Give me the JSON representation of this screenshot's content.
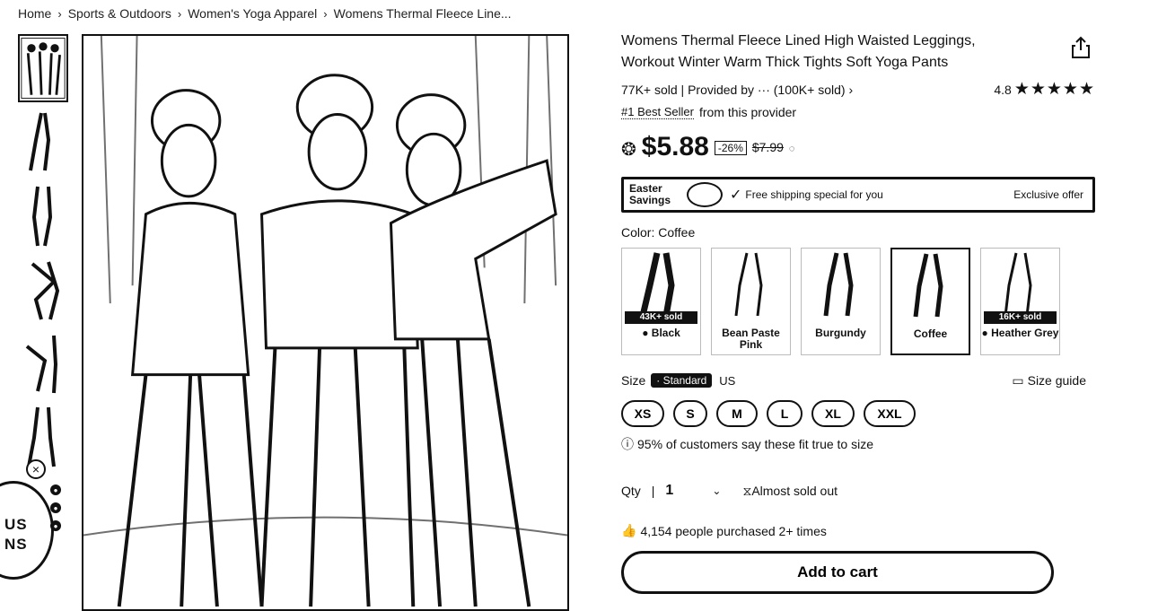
{
  "breadcrumb": [
    "Home",
    "Sports & Outdoors",
    "Women's Yoga Apparel",
    "Womens Thermal Fleece Line..."
  ],
  "promo_badge": [
    "US",
    "NS"
  ],
  "product": {
    "title": "Womens Thermal Fleece Lined High Waisted Leggings, Workout Winter Warm Thick Tights Soft Yoga Pants",
    "sold_provider": "77K+ sold | Provided by ··· (100K+ sold)",
    "rating_value": "4.8",
    "stars": "★★★★★",
    "best_seller_tag": "#1 Best Seller",
    "best_seller_suffix": "from this provider",
    "price": "$5.88",
    "discount": "-26%",
    "old_price": "$7.99"
  },
  "banner": {
    "easter": "Easter Savings",
    "shipping": "Free shipping special for you",
    "exclusive": "Exclusive offer"
  },
  "color": {
    "label": "Color: Coffee",
    "options": [
      {
        "name": "Black",
        "sold": "43K+ sold"
      },
      {
        "name": "Bean Paste Pink",
        "sold": ""
      },
      {
        "name": "Burgundy",
        "sold": ""
      },
      {
        "name": "Coffee",
        "sold": ""
      },
      {
        "name": "Heather Grey",
        "sold": "16K+ sold"
      }
    ]
  },
  "size": {
    "label": "Size",
    "standard": "Standard",
    "region": "US",
    "guide": "Size guide",
    "options": [
      "XS",
      "S",
      "M",
      "L",
      "XL",
      "XXL"
    ],
    "fit_note": "95% of customers say these fit true to size"
  },
  "qty": {
    "label": "Qty",
    "value": "1",
    "stock_note": "Almost sold out"
  },
  "purchased_note": "4,154 people purchased 2+ times",
  "cart_button": "Add to cart"
}
